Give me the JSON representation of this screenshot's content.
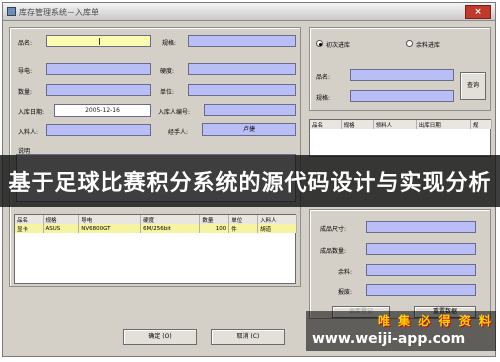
{
  "window": {
    "title": "库存管理系统－入库单",
    "close_label": "×"
  },
  "form": {
    "name_label": "品名:",
    "spec_label": "规格:",
    "conductor_label": "导电:",
    "hardness_label": "硬度:",
    "quantity_label": "数量:",
    "unit_label": "单位:",
    "date_label": "入库日期:",
    "date_value": "2005-12-16",
    "person_no_label": "入库人编号:",
    "stocker_label": "入料人:",
    "handler_label": "经手人:",
    "handler_value": "卢捷",
    "note_label": "说明"
  },
  "query": {
    "radio_first": "初次进库",
    "radio_surplus": "余料进库",
    "name_label": "品名:",
    "spec_label": "规格:",
    "query_button": "查询",
    "columns": [
      "品名",
      "规格",
      "领料人",
      "出库日期",
      "规"
    ]
  },
  "table": {
    "columns": [
      "品名",
      "规格",
      "导电",
      "硬度",
      "数量",
      "单位",
      "入料人"
    ],
    "rows": [
      [
        "显卡",
        "ASUS",
        "NV6800GT",
        "6M/256bit",
        "100",
        "件",
        "胡道"
      ]
    ]
  },
  "right_form": {
    "size_label": "成品尺寸:",
    "count_label": "成品数量:",
    "surplus_label": "余料:",
    "scrap_label": "报废:",
    "btn_disabled": "出库登记",
    "btn_reset": "重置数据"
  },
  "footer": {
    "ok_button": "确定 (O)",
    "cancel_button": "取消 (C)"
  },
  "overlay": {
    "headline": "基于足球比赛积分系统的源代码设计与实现分析",
    "watermark_logo": "唯 集 必 得 资 料",
    "watermark_url": "www.weiji-app.com"
  }
}
